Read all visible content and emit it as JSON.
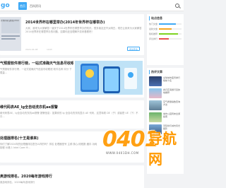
{
  "header": {
    "logo": "go",
    "nav": [
      {
        "label": "首页",
        "active": true
      },
      {
        "label": "百科资讯",
        "active": false
      }
    ],
    "accent": "#3fa9f5"
  },
  "articles": [
    {
      "thumb_caption": "世界杯青岛赛程(2014",
      "title": "2014世界杯在哪里举办(2014年世界杯在哪举办)",
      "summary": "大家，我来为大家解答一道关于2014世界杯在哪里举办的知识。很多朋友还不太明白，现在让我来为大家解答2014世界杯在哪里举办的问题，如果你还没理解不妨来看看吧！",
      "date": "2024-04-08",
      "views": "1043",
      "read_label": "阅读更多"
    },
    {
      "thumb_caption": "",
      "title": "气预报软件排行榜，一站式准确天气信息尽收眼底",
      "summary": "气预报软件排行榜，一站式准确天气信息尽收眼底 软件名称 评分 下载量...",
      "date": "",
      "views": "",
      "read_label": ""
    },
    {
      "thumb_caption": "",
      "title": "维代码表AE_lg全自动洗衣机ae报警",
      "summary": "维代码表AE，lg全自动洗衣机ae报警 报警信息：如果你的 lg 全自动洗衣机显示 AE 代码，这意味着 DE（子）或者是 UE（下）不平...",
      "date": "",
      "views": "",
      "read_label": ""
    },
    {
      "thumb_caption": "",
      "title": "处理器排名(十王是谁来)",
      "summary": "你们了解2024年的处理器排名是怎么样的吗？排名 处理器型号 主频 核心/线程数 缓存 功耗 制程 价格 1 Intel Core i9...",
      "date": "",
      "views": "",
      "read_label": ""
    },
    {
      "thumb_caption": "",
      "title": "奥游戏排名，2020每年游戏排行",
      "summary": "奥游戏排名，2020每年游戏排行",
      "date": "",
      "views": "",
      "read_label": ""
    }
  ],
  "sidebar": {
    "stats_title": "站点信息",
    "stats": [
      {
        "label": "热门文章",
        "value": 0.75,
        "color": "#3fa9f5"
      },
      {
        "label": "最新文章",
        "value": 0.55,
        "color": "#f5a623"
      },
      {
        "label": "随机推荐",
        "value": 0.85,
        "color": "#7ed321"
      },
      {
        "label": "评论排行",
        "value": 0.45,
        "color": "#e94e4e"
      }
    ],
    "hot_title": "热评文章",
    "hot": [
      "全球城市夜景排行榜前十名",
      "春日花海旅行目的地推荐",
      "空气质量指数查询方法",
      "城市公园周末出游指南",
      "天际线与城市风光摄影"
    ]
  },
  "watermark": {
    "digits": "0401",
    "cn": "导航网",
    "url": "WWW.0401DH.COM"
  }
}
